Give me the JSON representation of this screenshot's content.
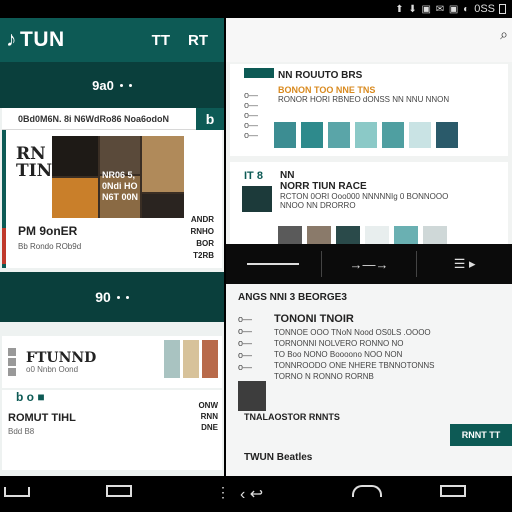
{
  "status_bar": {
    "icons": "⬆ ⬇ ▣ ✉ ▣ ◐",
    "carrier": "0SS"
  },
  "left": {
    "app_title": "TUN",
    "action_1": "TT",
    "action_2": "RT",
    "band1_text": "9a0",
    "band2_text": "90",
    "card1": {
      "header": "0Bd0M6N. 8i N6WdRo86 Noa6odoN",
      "tag": "b",
      "title": "RN\nTINE",
      "collage_caption": "NR06 5,\n0Ndi HO\nN6T 00N",
      "subtitle": "PM 9onER",
      "meta": "Bb Rondo ROb9d",
      "side_list": "ANDR\nRNHO\nBOR\nT2RB"
    },
    "card2": {
      "title": "FTUNND",
      "subtitle": "o0 Nnbn Oond"
    },
    "card3": {
      "marks": "b  o  ■",
      "title": "ROMUT TIHL",
      "subtitle": "Bdd B8",
      "side": "ONW\nRNN\nDNE"
    }
  },
  "right": {
    "top_icon": "⌕",
    "card1": {
      "title": "NN ROUUTO BRS",
      "highlight": "BONON TOO NNE TNS",
      "subtitle": "RONOR HORI RBNEO dONSS NN NNU NNON",
      "list_marks": "o—\no—\no—\no—\no—"
    },
    "swatch_colors": [
      "#3c8d92",
      "#2e8a8c",
      "#5aa5a8",
      "#8bc9c7",
      "#4f9fa1",
      "#c9e3e4",
      "#2a5a6a"
    ],
    "card2": {
      "number": "IT 8",
      "title": "NN",
      "headline": "NORR TIUN RACE",
      "body": "RCTON 0ORI Ooo000 NNNNNIg 0 BONNOOO",
      "subtitle": "NNOO NN DRORRO"
    },
    "row_thumb_colors": [
      "#5a5a5a",
      "#8a7a6a",
      "#2a4a4a",
      "#e8eeee",
      "#6ab0b2",
      "#cfd8d8"
    ],
    "player": {
      "play": "→—→"
    },
    "detail": {
      "title": "ANGS NNI 3 BEORGE3",
      "marks": "o—\no—\no—\no—\no—",
      "headline": "TONONI TNOIR",
      "body": "TONNOE OOO TNoN Nood OS0LS .OOOO\nTORNONNI NOLVERO RONNO NO\nTO Boo NONO Boooono NOO NON\nTONNROODO ONE NHERE TBNNOTONNS\nTORNO N RONNO RORNB",
      "footer": "TNALAOSTOR RNNTS",
      "button": "RNNT TT",
      "artist": "TWUN Beatles"
    }
  },
  "colors": {
    "primary": "#0d5a55",
    "primary_dark": "#0a3f3c",
    "accent_orange": "#d98a1f",
    "accent_red": "#c0392b"
  }
}
